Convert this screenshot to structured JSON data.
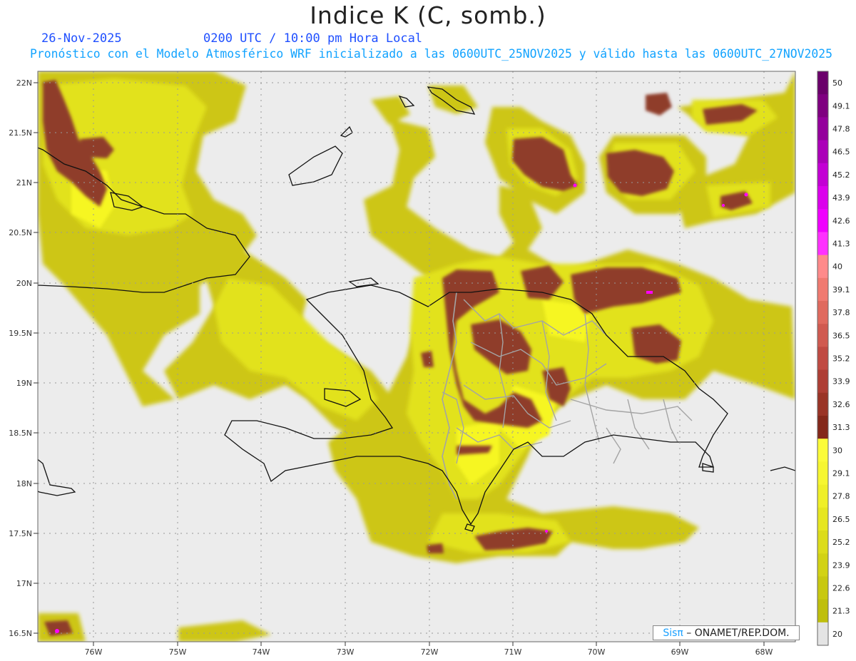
{
  "title": "Indice K (C, somb.)",
  "date": "26-Nov-2025",
  "time_line": "0200 UTC / 10:00 pm Hora Local",
  "forecast_line": "Pronóstico con el Modelo Atmosférico WRF inicializado a las 0600UTC_25NOV2025 y válido hasta las  0600UTC_27NOV2025",
  "credit": {
    "logo": "Sisπ",
    "text": " – ONAMET/REP.DOM."
  },
  "colors": {
    "background": "#ececec",
    "low": "#c9c20e",
    "mid": "#e3e31e",
    "high": "#f6f624",
    "brown": "#8f3c2a",
    "magenta": "#ff00ff",
    "coast": "#000000",
    "provinces": "#9a9a9a",
    "grid": "#999999"
  },
  "lat_labels": [
    "22N",
    "21.5N",
    "21N",
    "20.5N",
    "20N",
    "19.5N",
    "19N",
    "18.5N",
    "18N",
    "17.5N",
    "17N",
    "16.5N"
  ],
  "lon_labels": [
    "76W",
    "75W",
    "74W",
    "73W",
    "72W",
    "71W",
    "70W",
    "69W",
    "68W"
  ],
  "colorbar": {
    "labels": [
      "50",
      "49.1",
      "47.8",
      "46.5",
      "45.2",
      "43.9",
      "42.6",
      "41.3",
      "40",
      "39.1",
      "37.8",
      "36.5",
      "35.2",
      "33.9",
      "32.6",
      "31.3",
      "30",
      "29.1",
      "27.8",
      "26.5",
      "25.2",
      "23.9",
      "22.6",
      "21.3",
      "20"
    ],
    "colors": [
      "#6a006a",
      "#7f0080",
      "#94009c",
      "#ab00b8",
      "#c300d4",
      "#db00ec",
      "#f000ff",
      "#ff30ff",
      "#ff8a8a",
      "#f07a70",
      "#e06a5e",
      "#d05a50",
      "#c04a42",
      "#ae3e34",
      "#9a3426",
      "#84281a",
      "#fbfb38",
      "#f6f630",
      "#efef28",
      "#e6e620",
      "#dcdc1a",
      "#d2d214",
      "#c8c810",
      "#bfbf0c",
      "#e4e4e4"
    ]
  }
}
